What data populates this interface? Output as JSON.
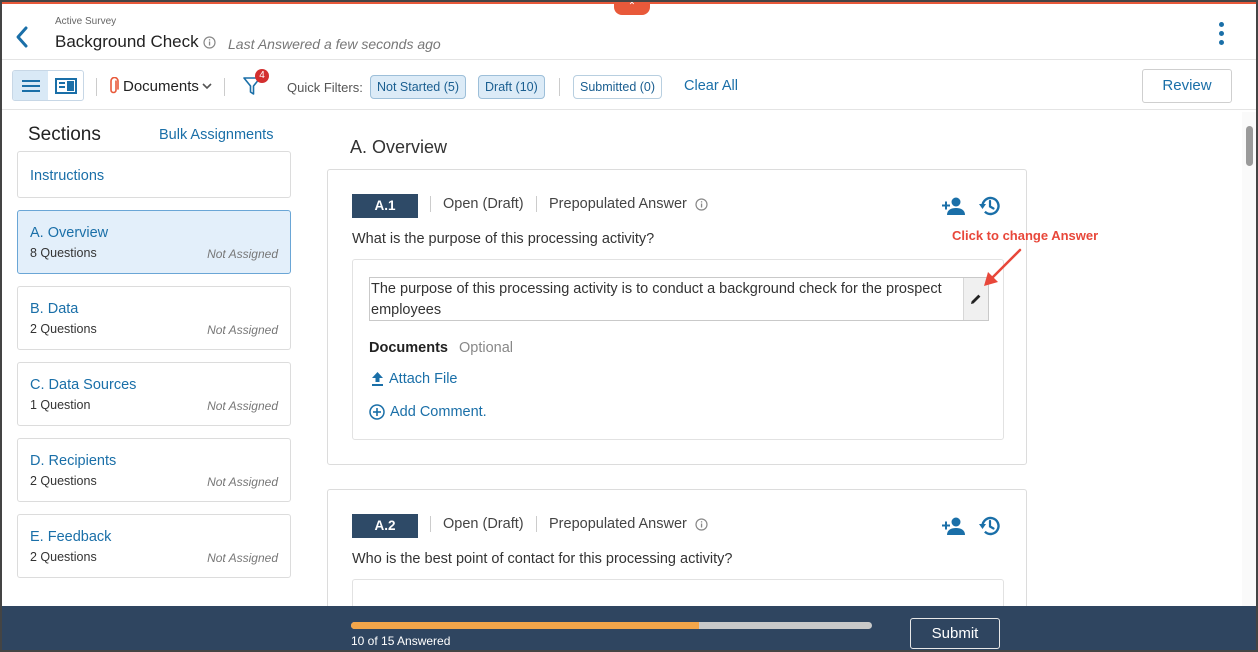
{
  "header": {
    "kicker": "Active Survey",
    "title": "Background Check",
    "last_answered": "Last Answered a few seconds ago"
  },
  "toolbar": {
    "documents_label": "Documents",
    "filter_badge": "4",
    "quick_filters_label": "Quick Filters:",
    "chips": {
      "not_started": "Not Started (5)",
      "draft": "Draft (10)",
      "submitted": "Submitted (0)"
    },
    "clear_all": "Clear All",
    "review": "Review"
  },
  "sidebar": {
    "title": "Sections",
    "bulk_assignments": "Bulk Assignments",
    "items": [
      {
        "name": "Instructions",
        "count": "",
        "assignment": ""
      },
      {
        "name": "A. Overview",
        "count": "8 Questions",
        "assignment": "Not Assigned",
        "active": true
      },
      {
        "name": "B. Data",
        "count": "2 Questions",
        "assignment": "Not Assigned"
      },
      {
        "name": "C. Data Sources",
        "count": "1 Question",
        "assignment": "Not Assigned"
      },
      {
        "name": "D. Recipients",
        "count": "2 Questions",
        "assignment": "Not Assigned"
      },
      {
        "name": "E. Feedback",
        "count": "2 Questions",
        "assignment": "Not Assigned"
      }
    ]
  },
  "main": {
    "section_title": "A. Overview",
    "questions": [
      {
        "id": "A.1",
        "status": "Open (Draft)",
        "prepopulated": "Prepopulated Answer",
        "text": "What is the purpose of this processing activity?",
        "answer": "The purpose of this processing activity is to conduct a background check for the prospect employees",
        "documents_label": "Documents",
        "documents_optional": "Optional",
        "attach_file": "Attach File",
        "add_comment": "Add Comment."
      },
      {
        "id": "A.2",
        "status": "Open (Draft)",
        "prepopulated": "Prepopulated Answer",
        "text": "Who is the best point of contact for this processing activity?"
      }
    ],
    "annotation": "Click to change Answer"
  },
  "footer": {
    "progress_text": "10 of 15 Answered",
    "progress_fraction": 0.667,
    "submit": "Submit"
  },
  "colors": {
    "accent": "#1a6fa8",
    "navy": "#2e4a67",
    "footer_bg": "#2f4560",
    "progress": "#f2a54a",
    "annotation": "#e8473a",
    "badge": "#d32f2f"
  }
}
